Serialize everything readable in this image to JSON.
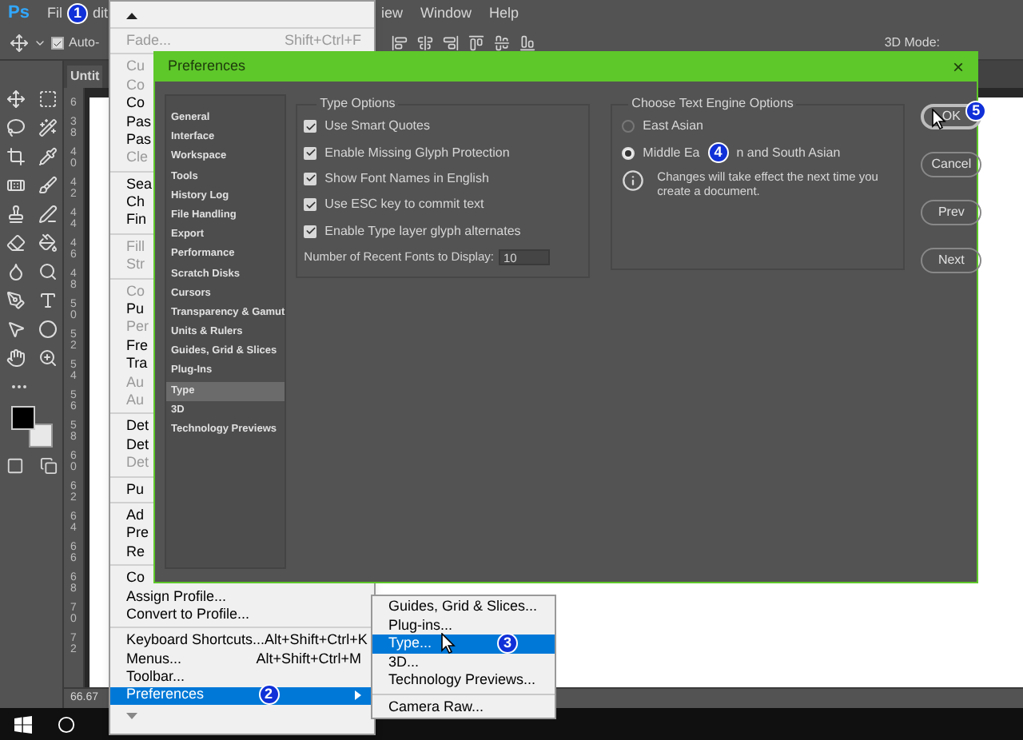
{
  "menu_bar": {
    "logo": "Ps",
    "items": [
      "Fil",
      "dit",
      "iew",
      "Window",
      "Help"
    ],
    "badge": "1"
  },
  "options_bar": {
    "auto_select": {
      "label": "Auto-",
      "checked": true
    },
    "mode_label": "3D Mode:"
  },
  "document": {
    "tab": "Untit",
    "ruler": [
      "6",
      "38",
      "40",
      "42",
      "44",
      "46",
      "48",
      "50",
      "52",
      "54",
      "56",
      "58",
      "60",
      "62",
      "64",
      "66",
      "68",
      "70",
      "72"
    ],
    "zoom": "66.67"
  },
  "edit_menu": {
    "sections": [
      [
        {
          "label": "Fade...",
          "shortcut": "Shift+Ctrl+F",
          "disabled": true,
          "selected": false
        }
      ],
      [
        {
          "label": "Cu",
          "disabled": true,
          "selected": false
        },
        {
          "label": "Co",
          "disabled": true,
          "selected": false
        },
        {
          "label": "Co",
          "disabled": false,
          "selected": false
        },
        {
          "label": "Pas",
          "disabled": false,
          "selected": false
        },
        {
          "label": "Pas",
          "disabled": false,
          "selected": false
        },
        {
          "label": "Cle",
          "disabled": true,
          "selected": false
        }
      ],
      [
        {
          "label": "Sea",
          "disabled": false,
          "selected": false
        },
        {
          "label": "Ch",
          "disabled": false,
          "selected": false
        },
        {
          "label": "Fin",
          "disabled": false,
          "selected": false
        }
      ],
      [
        {
          "label": "Fill",
          "disabled": true,
          "selected": false
        },
        {
          "label": "Str",
          "disabled": true,
          "selected": false
        }
      ],
      [
        {
          "label": "Co",
          "disabled": true,
          "selected": false
        },
        {
          "label": "Pu",
          "disabled": false,
          "selected": false
        },
        {
          "label": "Per",
          "disabled": true,
          "selected": false
        },
        {
          "label": "Fre",
          "disabled": false,
          "selected": false
        },
        {
          "label": "Tra",
          "disabled": false,
          "selected": false
        },
        {
          "label": "Au",
          "disabled": true,
          "selected": false
        },
        {
          "label": "Au",
          "disabled": true,
          "selected": false
        }
      ],
      [
        {
          "label": "Det",
          "disabled": false,
          "selected": false
        },
        {
          "label": "Det",
          "disabled": false,
          "selected": false
        },
        {
          "label": "Det",
          "disabled": true,
          "selected": false
        }
      ],
      [
        {
          "label": "Pu",
          "disabled": false,
          "selected": false
        }
      ],
      [
        {
          "label": "Ad",
          "disabled": false,
          "selected": false
        },
        {
          "label": "Pre",
          "disabled": false,
          "selected": false
        },
        {
          "label": "Re",
          "disabled": false,
          "selected": false
        }
      ],
      [
        {
          "label": "Co",
          "disabled": false,
          "selected": false
        },
        {
          "label": "Assign Profile...",
          "disabled": false,
          "selected": false
        },
        {
          "label": "Convert to Profile...",
          "disabled": false,
          "selected": false
        }
      ],
      [
        {
          "label": "Keyboard Shortcuts...",
          "shortcut": "Alt+Shift+Ctrl+K",
          "disabled": false,
          "selected": false
        },
        {
          "label": "Menus...",
          "shortcut": "Alt+Shift+Ctrl+M",
          "disabled": false,
          "selected": false
        },
        {
          "label": "Toolbar...",
          "disabled": false,
          "selected": false
        },
        {
          "label": "Preferences",
          "disabled": false,
          "selected": true,
          "submenu": true,
          "badge": "2"
        }
      ]
    ]
  },
  "preferences_submenu": {
    "sections": [
      [
        {
          "label": "Guides, Grid & Slices...",
          "selected": false
        },
        {
          "label": "Plug-ins...",
          "selected": false
        },
        {
          "label": "Type...",
          "selected": true,
          "badge": "3"
        },
        {
          "label": "3D...",
          "selected": false
        },
        {
          "label": "Technology Previews...",
          "selected": false
        }
      ],
      [
        {
          "label": "Camera Raw...",
          "selected": false
        }
      ]
    ]
  },
  "dialog": {
    "title": "Preferences",
    "close": "×",
    "sidebar": [
      {
        "label": "General",
        "selected": false
      },
      {
        "label": "Interface",
        "selected": false
      },
      {
        "label": "Workspace",
        "selected": false
      },
      {
        "label": "Tools",
        "selected": false
      },
      {
        "label": "History Log",
        "selected": false
      },
      {
        "label": "File Handling",
        "selected": false
      },
      {
        "label": "Export",
        "selected": false
      },
      {
        "label": "Performance",
        "selected": false
      },
      {
        "label": "Scratch Disks",
        "selected": false
      },
      {
        "label": "Cursors",
        "selected": false
      },
      {
        "label": "Transparency & Gamut",
        "selected": false
      },
      {
        "label": "Units & Rulers",
        "selected": false
      },
      {
        "label": "Guides, Grid & Slices",
        "selected": false
      },
      {
        "label": "Plug-Ins",
        "selected": false
      },
      {
        "label": "Type",
        "selected": true
      },
      {
        "label": "3D",
        "selected": false
      },
      {
        "label": "Technology Previews",
        "selected": false
      }
    ],
    "type_options": {
      "title": "Type Options",
      "checkboxes": [
        {
          "label": "Use Smart Quotes",
          "checked": true
        },
        {
          "label": "Enable Missing Glyph Protection",
          "checked": true
        },
        {
          "label": "Show Font Names in English",
          "checked": true
        },
        {
          "label": "Use ESC key to commit text",
          "checked": true
        },
        {
          "label": "Enable Type layer glyph alternates",
          "checked": true
        }
      ],
      "recent_fonts": {
        "label": "Number of Recent Fonts to Display:",
        "value": "10"
      }
    },
    "text_engine": {
      "title": "Choose Text Engine Options",
      "radios": [
        {
          "label": "East Asian",
          "selected": false
        },
        {
          "label": "Middle Ea",
          "label_after_badge": "n and South Asian",
          "badge": "4",
          "selected": true
        }
      ],
      "info": "Changes will take effect the next time you create a document."
    },
    "buttons": [
      {
        "label": "OK",
        "default": true,
        "badge": "5"
      },
      {
        "label": "Cancel",
        "default": false
      },
      {
        "label": "Prev",
        "default": false
      },
      {
        "label": "Next",
        "default": false
      }
    ]
  }
}
